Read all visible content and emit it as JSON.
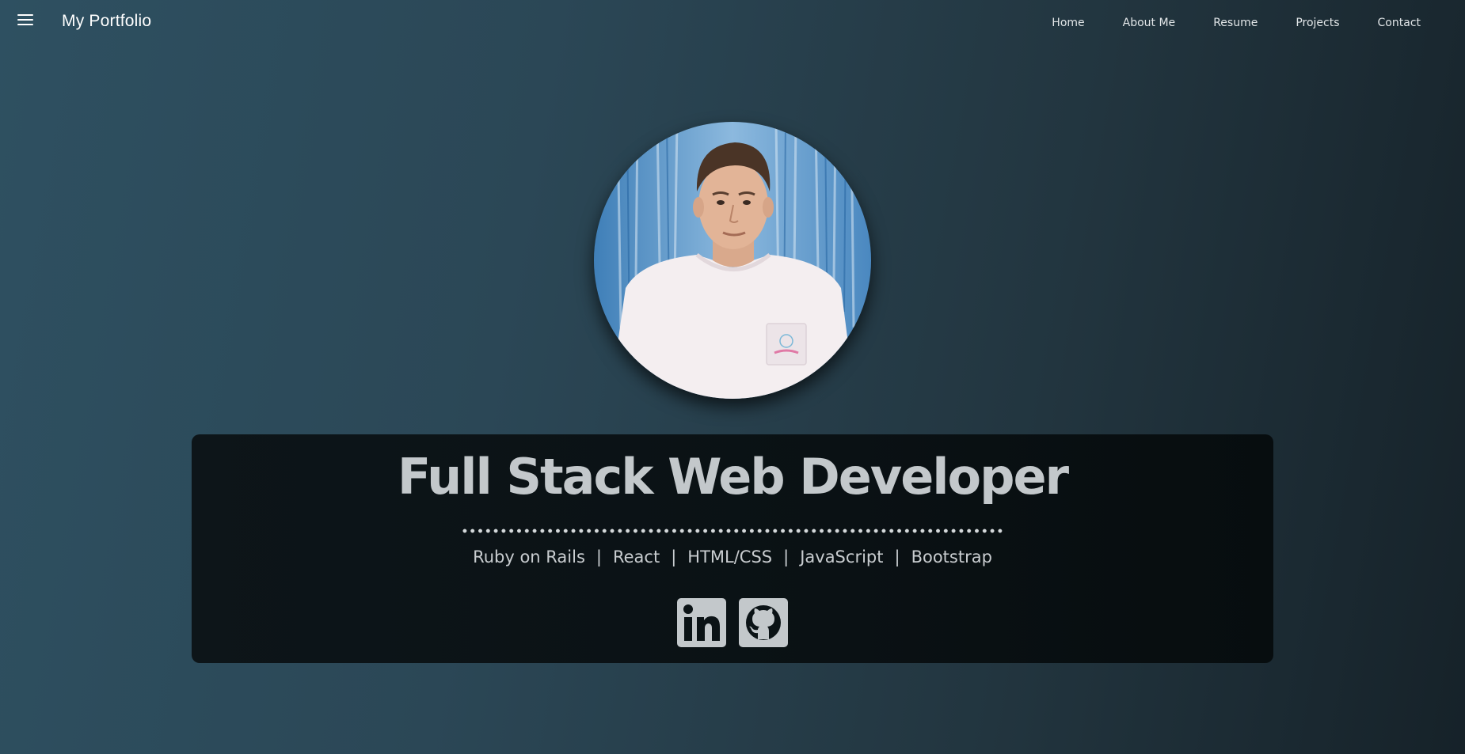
{
  "nav": {
    "brand": "My Portfolio",
    "links": [
      "Home",
      "About Me",
      "Resume",
      "Projects",
      "Contact"
    ],
    "menu_icon": "hamburger-menu-icon"
  },
  "hero": {
    "title": "Full Stack Web Developer",
    "skills": [
      "Ruby on Rails",
      "React",
      "HTML/CSS",
      "JavaScript",
      "Bootstrap"
    ],
    "separator": "|",
    "socials": [
      {
        "icon": "linkedin-icon"
      },
      {
        "icon": "github-icon"
      }
    ]
  },
  "colors": {
    "background_left": "#2e5061",
    "background_right": "#162229",
    "card": "#0b1316",
    "title_text": "#c3c8cb",
    "icon_fill": "#c3c8cb"
  }
}
